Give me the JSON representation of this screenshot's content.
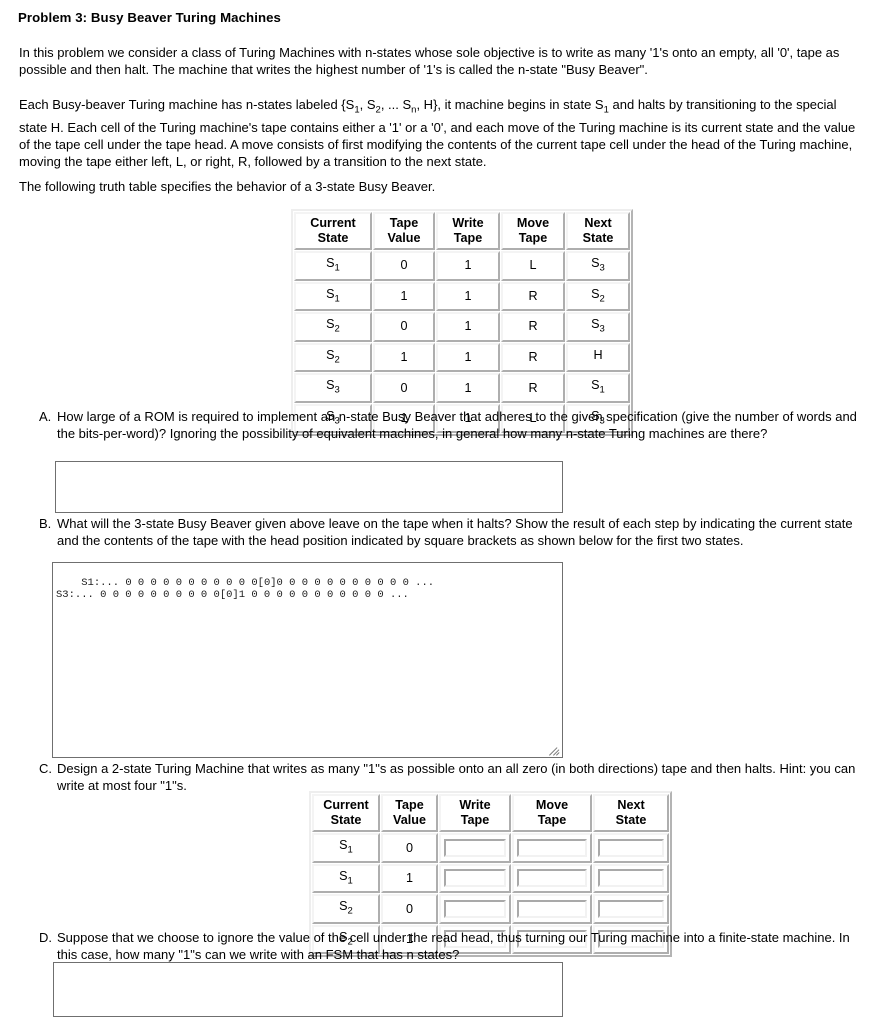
{
  "problem": {
    "title": "Problem 3: Busy Beaver Turing Machines",
    "paragraph1": "In this problem we consider a class of Turing Machines with n-states whose sole objective is to write as many '1's onto an empty, all '0', tape as possible and then halt. The machine that writes the highest number of '1's is called the n-state \"Busy Beaver\".",
    "paragraph3": "The following truth table specifies the behavior of a 3-state Busy Beaver."
  },
  "table1": {
    "headers": [
      "Current State",
      "Tape Value",
      "Write Tape",
      "Move Tape",
      "Next State"
    ],
    "header_lines": [
      [
        "Current",
        "State"
      ],
      [
        "Tape",
        "Value"
      ],
      [
        "Write",
        "Tape"
      ],
      [
        "Move",
        "Tape"
      ],
      [
        "Next",
        "State"
      ]
    ],
    "rows": [
      {
        "current_state": "S1",
        "current_state_base": "S",
        "current_state_sub": "1",
        "tape_value": "0",
        "write_tape": "1",
        "move_tape": "L",
        "next_state_base": "S",
        "next_state_sub": "3"
      },
      {
        "current_state": "S1",
        "current_state_base": "S",
        "current_state_sub": "1",
        "tape_value": "1",
        "write_tape": "1",
        "move_tape": "R",
        "next_state_base": "S",
        "next_state_sub": "2"
      },
      {
        "current_state": "S2",
        "current_state_base": "S",
        "current_state_sub": "2",
        "tape_value": "0",
        "write_tape": "1",
        "move_tape": "R",
        "next_state_base": "S",
        "next_state_sub": "3"
      },
      {
        "current_state": "S2",
        "current_state_base": "S",
        "current_state_sub": "2",
        "tape_value": "1",
        "write_tape": "1",
        "move_tape": "R",
        "next_state_base": "H",
        "next_state_sub": ""
      },
      {
        "current_state": "S3",
        "current_state_base": "S",
        "current_state_sub": "3",
        "tape_value": "0",
        "write_tape": "1",
        "move_tape": "R",
        "next_state_base": "S",
        "next_state_sub": "1"
      },
      {
        "current_state": "S3",
        "current_state_base": "S",
        "current_state_sub": "3",
        "tape_value": "1",
        "write_tape": "1",
        "move_tape": "L",
        "next_state_base": "S",
        "next_state_sub": "3"
      }
    ]
  },
  "table2": {
    "header_lines": [
      [
        "Current",
        "State"
      ],
      [
        "Tape",
        "Value"
      ],
      [
        "Write",
        "Tape"
      ],
      [
        "Move",
        "Tape"
      ],
      [
        "Next",
        "State"
      ]
    ],
    "rows": [
      {
        "current_state_base": "S",
        "current_state_sub": "1",
        "tape_value": "0",
        "write_tape": "",
        "move_tape": "",
        "next_state": ""
      },
      {
        "current_state_base": "S",
        "current_state_sub": "1",
        "tape_value": "1",
        "write_tape": "",
        "move_tape": "",
        "next_state": ""
      },
      {
        "current_state_base": "S",
        "current_state_sub": "2",
        "tape_value": "0",
        "write_tape": "",
        "move_tape": "",
        "next_state": ""
      },
      {
        "current_state_base": "S",
        "current_state_sub": "2",
        "tape_value": "1",
        "write_tape": "",
        "move_tape": "",
        "next_state": ""
      }
    ]
  },
  "items": {
    "A": {
      "letter": "A.",
      "text": "How large of a ROM is required to implement an n-state Busy Beaver that adheres to the given specification (give the number of words and the bits-per-word)? Ignoring the possibility of equivalent machines, in general how many n-state Turing machines are there?",
      "answer_value": ""
    },
    "B": {
      "letter": "B.",
      "text": "What will the 3-state Busy Beaver given above leave on the tape when it halts? Show the result of each step by indicating the current state and the contents of the tape with the head position indicated by square brackets as shown below for the first two states.",
      "answer_value": "S1:... 0 0 0 0 0 0 0 0 0 0 0[0]0 0 0 0 0 0 0 0 0 0 0 ...\nS3:... 0 0 0 0 0 0 0 0 0 0[0]1 0 0 0 0 0 0 0 0 0 0 0 ..."
    },
    "C": {
      "letter": "C.",
      "text": "Design a 2-state Turing Machine that writes as many \"1\"s as possible onto an all zero (in both directions) tape and then halts. Hint: you can write at most four \"1\"s."
    },
    "D": {
      "letter": "D.",
      "text": "Suppose that we choose to ignore the value of the cell under the read head, thus turning our Turing machine into a finite-state machine. In this case, how many \"1\"s can we write with an FSM that has n states?",
      "answer_value": ""
    }
  },
  "colors": {
    "text": "#000000",
    "page_background": "#ffffff",
    "box_border": "#6f6f6f",
    "table_cell_border": "#aeaeae"
  }
}
